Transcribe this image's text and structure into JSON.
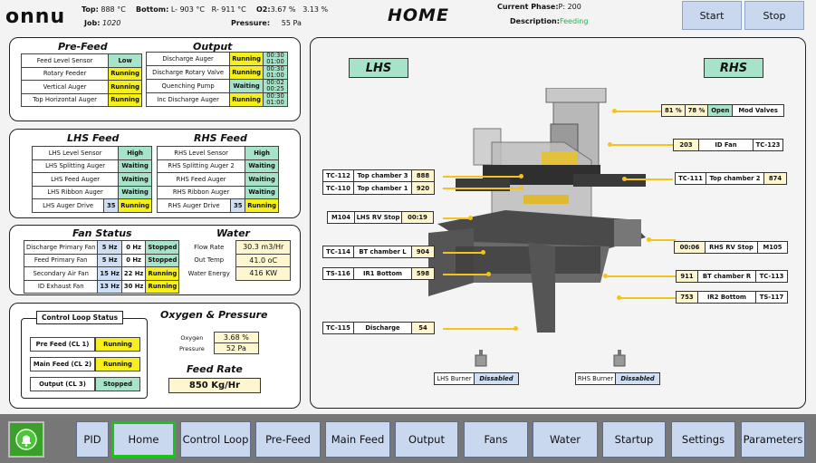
{
  "header": {
    "logo": "onnu",
    "top_label": "Top:",
    "top_value": "888 °C",
    "bottom_label": "Bottom:",
    "bottom_l": "L- 903 °C",
    "bottom_r": "R- 911 °C",
    "o2_label": "O2:",
    "o2_value": "3.67 %",
    "o2_value2": "3.13 %",
    "job_label": "Job:",
    "job_value": "1020",
    "pressure_label": "Pressure:",
    "pressure_value": "55 Pa",
    "title": "HOME",
    "phase_label": "Current Phase:",
    "phase_value": "P:  200",
    "desc_label": "Description:",
    "desc_value": "Feeding",
    "start_label": "Start",
    "stop_label": "Stop"
  },
  "prefeed": {
    "title": "Pre-Feed",
    "rows": [
      {
        "label": "Feed Level Sensor",
        "status": "Low"
      },
      {
        "label": "Rotary Feeder",
        "status": "Running"
      },
      {
        "label": "Vertical Auger",
        "status": "Running"
      },
      {
        "label": "Top Horizontal Auger",
        "status": "Running"
      }
    ]
  },
  "output": {
    "title": "Output",
    "rows": [
      {
        "label": "Discharge Auger",
        "status": "Running",
        "t1": "00:30",
        "t2": "01:00"
      },
      {
        "label": "Discharge Rotary Valve",
        "status": "Running",
        "t1": "00:30",
        "t2": "01:00"
      },
      {
        "label": "Quenching Pump",
        "status": "Waiting",
        "t1": "00:02",
        "t2": "00:25"
      },
      {
        "label": "Inc Discharge Auger",
        "status": "Running",
        "t1": "00:30",
        "t2": "01:00"
      }
    ]
  },
  "lhsfeed": {
    "title": "LHS Feed",
    "rows": [
      {
        "label": "LHS Level Sensor",
        "status": "High"
      },
      {
        "label": "LHS Splitting Auger",
        "status": "Waiting"
      },
      {
        "label": "LHS Feed Auger",
        "status": "Waiting"
      },
      {
        "label": "LHS Ribbon Auger",
        "status": "Waiting"
      }
    ],
    "drive_label": "LHS Auger Drive",
    "drive_value": "35",
    "drive_status": "Running"
  },
  "rhsfeed": {
    "title": "RHS Feed",
    "rows": [
      {
        "label": "RHS Level Sensor",
        "status": "High"
      },
      {
        "label": "RHS Splitting Auger 2",
        "status": "Waiting"
      },
      {
        "label": "RHS Feed Auger",
        "status": "Waiting"
      },
      {
        "label": "RHS Ribbon Auger",
        "status": "Waiting"
      }
    ],
    "drive_label": "RHS Auger Drive",
    "drive_value": "35",
    "drive_status": "Running"
  },
  "fans": {
    "title": "Fan Status",
    "rows": [
      {
        "label": "Discharge Primary Fan",
        "sp": "5 Hz",
        "fb": "0 Hz",
        "status": "Stopped"
      },
      {
        "label": "Feed Primary Fan",
        "sp": "5 Hz",
        "fb": "0 Hz",
        "status": "Stopped"
      },
      {
        "label": "Secondary Air Fan",
        "sp": "15 Hz",
        "fb": "22 Hz",
        "status": "Running"
      },
      {
        "label": "ID Exhaust Fan",
        "sp": "13 Hz",
        "fb": "30 Hz",
        "status": "Running"
      }
    ]
  },
  "water": {
    "title": "Water",
    "rows": [
      {
        "label": "Flow Rate",
        "value": "30.3 m3/Hr"
      },
      {
        "label": "Out Temp",
        "value": "41.0 oC"
      },
      {
        "label": "Water Energy",
        "value": "416 KW"
      }
    ]
  },
  "control_loop": {
    "title": "Control Loop Status",
    "rows": [
      {
        "label": "Pre Feed (CL 1)",
        "status": "Running"
      },
      {
        "label": "Main Feed (CL 2)",
        "status": "Running"
      },
      {
        "label": "Output (CL 3)",
        "status": "Stopped"
      }
    ]
  },
  "oxygen": {
    "title": "Oxygen & Pressure",
    "oxygen_label": "Oxygen",
    "oxygen_value": "3.68 %",
    "pressure_label": "Pressure",
    "pressure_value": "52 Pa"
  },
  "feedrate": {
    "title": "Feed Rate",
    "value": "850 Kg/Hr"
  },
  "diagram": {
    "lhs_label": "LHS",
    "rhs_label": "RHS",
    "mod_valves": {
      "v1": "81 %",
      "v2": "78 %",
      "state": "Open",
      "label": "Mod Valves"
    },
    "id_fan": {
      "value": "203",
      "label": "ID Fan",
      "tag": "TC-123"
    },
    "top_ch3": {
      "tag": "TC-112",
      "label": "Top chamber 3",
      "value": "888"
    },
    "top_ch1": {
      "tag": "TC-110",
      "label": "Top chamber 1",
      "value": "920"
    },
    "top_ch2": {
      "tag": "TC-111",
      "label": "Top chamber 2",
      "value": "874"
    },
    "lhs_rv": {
      "tag": "M104",
      "label": "LHS RV Stop",
      "value": "00:19"
    },
    "bt_l": {
      "tag": "TC-114",
      "label": "BT chamber L",
      "value": "904"
    },
    "rhs_rv": {
      "value": "00:06",
      "label": "RHS RV Stop",
      "tag": "M105"
    },
    "ir1": {
      "tag": "TS-116",
      "label": "IR1 Bottom",
      "value": "598"
    },
    "bt_r": {
      "value": "911",
      "label": "BT chamber R",
      "tag": "TC-113"
    },
    "ir2": {
      "value": "753",
      "label": "IR2 Bottom",
      "tag": "TS-117"
    },
    "discharge": {
      "tag": "TC-115",
      "label": "Discharge",
      "value": "54"
    },
    "lhs_burner": {
      "label": "LHS Burner",
      "state": "Dissabled"
    },
    "rhs_burner": {
      "label": "RHS Burner",
      "state": "Dissabled"
    }
  },
  "nav": {
    "items": [
      "PID",
      "Home",
      "Control Loop",
      "Pre-Feed",
      "Main Feed",
      "Output",
      "Fans",
      "Water",
      "Startup",
      "Settings",
      "Parameters"
    ],
    "active": "Home"
  },
  "colors": {
    "running": "#f5ef1e",
    "waiting": "#a7e3c9",
    "accent_green": "#19c519",
    "button_blue": "#c9d8ef",
    "line_yellow": "#f6c21c"
  },
  "icons": {
    "alarm": "alarm-bell-icon",
    "burner": "burner-icon"
  }
}
